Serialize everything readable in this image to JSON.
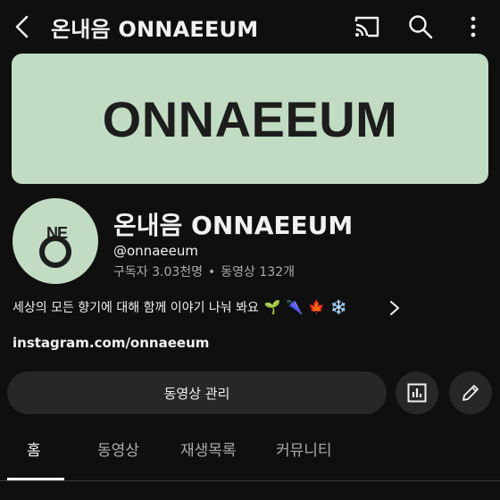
{
  "header": {
    "title": "온내음 ONNAEEUM"
  },
  "banner": {
    "text": "ONNAEEUM"
  },
  "channel": {
    "name": "온내음 ONNAEEUM",
    "handle": "@onnaeeum",
    "subscribers": "구독자 3.03천명",
    "separator": "•",
    "videos": "동영상 132개",
    "avatar_letters": [
      "N",
      "E",
      "O"
    ],
    "description": "세상의 모든 향기에 대해 함께 이야기 나눠 봐요",
    "description_emojis": [
      "🌱",
      "🌂",
      "🍁",
      "❄️"
    ],
    "link": "instagram.com/onnaeeum"
  },
  "actions": {
    "manage_label": "동영상 관리"
  },
  "tabs": [
    {
      "label": "홈",
      "active": true
    },
    {
      "label": "동영상",
      "active": false
    },
    {
      "label": "재생목록",
      "active": false
    },
    {
      "label": "커뮤니티",
      "active": false
    }
  ],
  "colors": {
    "background": "#0f0f0f",
    "banner": "#c2dcc3",
    "button": "#272727",
    "text": "#f1f1f1",
    "muted": "#aaaaaa"
  }
}
